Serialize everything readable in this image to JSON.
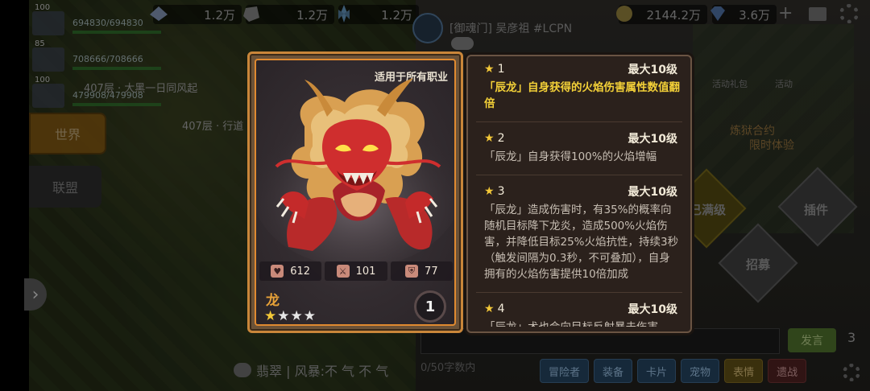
{
  "resources": {
    "res1": "1.2万",
    "res2": "1.2万",
    "res3": "1.2万",
    "gold": "2144.2万",
    "gems": "3.6万"
  },
  "players": [
    {
      "level": "100",
      "hp": "694830/694830"
    },
    {
      "level": "85",
      "hp": "708666/708666"
    },
    {
      "level": "100",
      "hp": "479908/479908"
    }
  ],
  "floor_texts": {
    "f1": "407层 · 大黑一日同风起",
    "f2": "407层 · 行道"
  },
  "left_tabs": {
    "world": "世界",
    "guild": "联盟"
  },
  "chat": {
    "sender": "[御魂门] 吴彦祖 #LCPN",
    "placeholder_count": "0/50字数内",
    "send_label": "发言",
    "badge": "3",
    "last_line": "翡翠 | 风暴:不 气 不 气"
  },
  "right_labels": {
    "activity_gift": "活动礼包",
    "activity": "活动",
    "promo_1": "炼狱合约",
    "promo_2": "限时体验",
    "maxed": "已满级",
    "plugin": "插件",
    "recruit": "招募"
  },
  "bottom_tabs": [
    {
      "label": "冒险者",
      "style": "blue"
    },
    {
      "label": "装备",
      "style": "blue"
    },
    {
      "label": "卡片",
      "style": "blue"
    },
    {
      "label": "宠物",
      "style": "blue"
    },
    {
      "label": "表情",
      "style": "hl"
    },
    {
      "label": "遗战",
      "style": "red"
    }
  ],
  "card": {
    "applicability": "适用于所有职业",
    "name": "龙",
    "stars_filled": 1,
    "stars_total": 4,
    "count": "1",
    "hp": "612",
    "attack": "101",
    "defense": "77",
    "colors": {
      "frame": "#c9863a",
      "name": "#e8a238",
      "star": "#f3c838"
    }
  },
  "skills": [
    {
      "star": "★",
      "rank": "1",
      "max": "最大10级",
      "desc": "「辰龙」自身获得的火焰伤害属性数值翻倍",
      "active": true
    },
    {
      "star": "★",
      "rank": "2",
      "max": "最大10级",
      "desc": "「辰龙」自身获得100%的火焰增幅",
      "active": false
    },
    {
      "star": "★",
      "rank": "3",
      "max": "最大10级",
      "desc": "「辰龙」造成伤害时，有35%的概率向随机目标降下龙炎，造成500%火焰伤害，并降低目标25%火焰抗性，持续3秒（触发间隔为0.3秒，不可叠加），自身拥有的火焰伤害提供10倍加成",
      "active": false
    },
    {
      "star": "★",
      "rank": "4",
      "max": "最大10级",
      "desc": "「辰龙」术也会向目标反射暴击伤害",
      "active": false
    }
  ]
}
